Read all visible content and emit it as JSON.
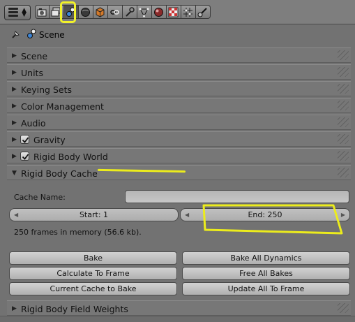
{
  "header": {
    "editor_icon": "properties-editor-icon",
    "context_tabs": [
      {
        "name": "render-icon",
        "active": false
      },
      {
        "name": "render-layers-icon",
        "active": false
      },
      {
        "name": "scene-icon",
        "active": true
      },
      {
        "name": "world-icon",
        "active": false
      },
      {
        "name": "object-icon",
        "active": false
      },
      {
        "name": "constraints-icon",
        "active": false
      },
      {
        "name": "modifiers-icon",
        "active": false
      },
      {
        "name": "object-data-icon",
        "active": false
      },
      {
        "name": "material-icon",
        "active": false
      },
      {
        "name": "texture-icon",
        "active": false
      },
      {
        "name": "particles-icon",
        "active": false
      },
      {
        "name": "physics-icon",
        "active": false
      }
    ],
    "highlight_color": "#f1f12a"
  },
  "breadcrumb": {
    "label": "Scene",
    "pin_icon": "pin-icon",
    "scene_icon": "scene-icon"
  },
  "panels": {
    "scene": "Scene",
    "units": "Units",
    "keying_sets": "Keying Sets",
    "color_management": "Color Management",
    "audio": "Audio",
    "gravity": "Gravity",
    "rigid_body_world": "Rigid Body World",
    "rigid_body_cache": "Rigid Body Cache",
    "rigid_body_field_weights": "Rigid Body Field Weights"
  },
  "checks": {
    "gravity": true,
    "rigid_body_world": true
  },
  "cache": {
    "cache_name_label": "Cache Name:",
    "cache_name_value": "",
    "start": "Start: 1",
    "end": "End: 250",
    "info": "250 frames in memory (56.6 kb).",
    "buttons": {
      "bake": "Bake",
      "bake_all_dynamics": "Bake All Dynamics",
      "calculate_to_frame": "Calculate To Frame",
      "free_all_bakes": "Free All Bakes",
      "current_cache_to_bake": "Current Cache to Bake",
      "update_all_to_frame": "Update All To Frame"
    }
  },
  "colors": {
    "background": "#727272",
    "annotation": "#ecec1c"
  }
}
